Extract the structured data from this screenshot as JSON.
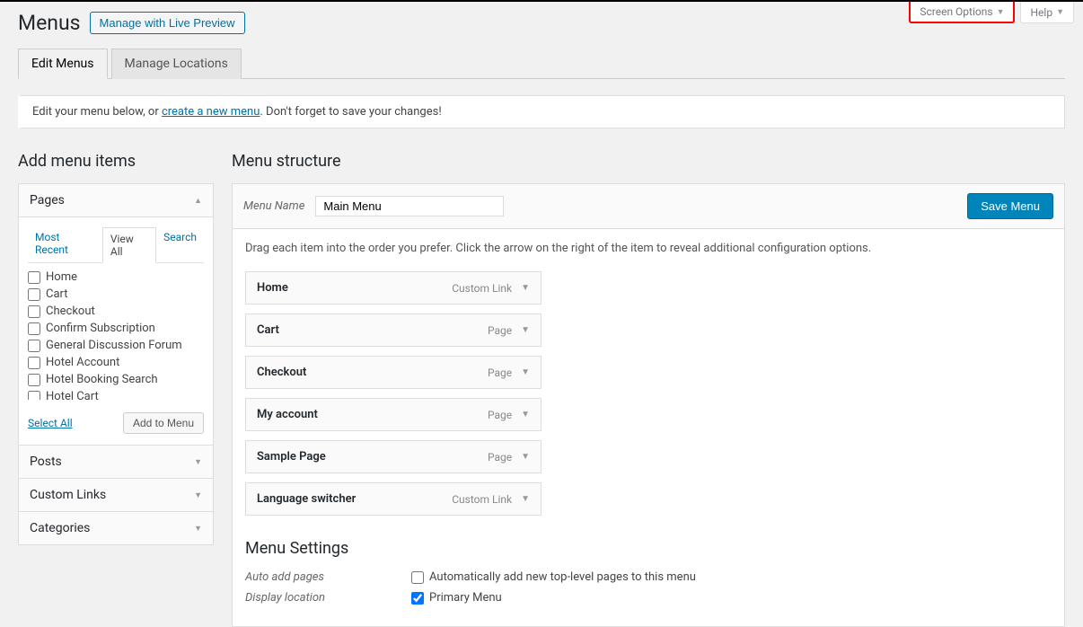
{
  "top_tabs": {
    "screen_options": "Screen Options",
    "help": "Help"
  },
  "header": {
    "title": "Menus",
    "live_preview": "Manage with Live Preview"
  },
  "nav_tabs": {
    "edit": "Edit Menus",
    "locations": "Manage Locations"
  },
  "notice": {
    "prefix": "Edit your menu below, or ",
    "link": "create a new menu",
    "suffix": ". Don't forget to save your changes!"
  },
  "left": {
    "heading": "Add menu items",
    "pages_title": "Pages",
    "inner_tabs": {
      "recent": "Most Recent",
      "view_all": "View All",
      "search": "Search"
    },
    "pages": [
      "Home",
      "Cart",
      "Checkout",
      "Confirm Subscription",
      "General Discussion Forum",
      "Hotel Account",
      "Hotel Booking Search",
      "Hotel Cart"
    ],
    "select_all": "Select All",
    "add_to_menu": "Add to Menu",
    "posts_title": "Posts",
    "custom_links_title": "Custom Links",
    "categories_title": "Categories"
  },
  "right": {
    "heading": "Menu structure",
    "menu_name_label": "Menu Name",
    "menu_name_value": "Main Menu",
    "save_btn": "Save Menu",
    "instructions": "Drag each item into the order you prefer. Click the arrow on the right of the item to reveal additional configuration options.",
    "items": [
      {
        "title": "Home",
        "type": "Custom Link"
      },
      {
        "title": "Cart",
        "type": "Page"
      },
      {
        "title": "Checkout",
        "type": "Page"
      },
      {
        "title": "My account",
        "type": "Page"
      },
      {
        "title": "Sample Page",
        "type": "Page"
      },
      {
        "title": "Language switcher",
        "type": "Custom Link"
      }
    ],
    "settings_heading": "Menu Settings",
    "settings": {
      "auto_add_label": "Auto add pages",
      "auto_add_text": "Automatically add new top-level pages to this menu",
      "display_loc_label": "Display location",
      "display_loc_text": "Primary Menu"
    }
  }
}
